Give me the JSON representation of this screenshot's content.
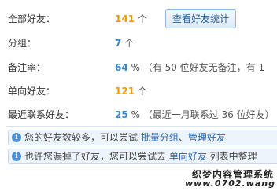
{
  "stats": {
    "total": {
      "label": "全部好友：",
      "value": "141",
      "unit": "个"
    },
    "groups": {
      "label": "分组：",
      "value": "7",
      "unit": "个"
    },
    "note_rate": {
      "label": "备注率：",
      "value": "64",
      "unit": "%",
      "detail": "（有 50 位好友无备注，有 1"
    },
    "one_way": {
      "label": "单向好友：",
      "value": "121",
      "unit": "个"
    },
    "recent": {
      "label": "最近联系好友：",
      "value": "25",
      "unit": "%",
      "detail": "（最近一月联系过 36 位好友）"
    }
  },
  "buttons": {
    "view_stats": "查看好友统计"
  },
  "tips": [
    {
      "prefix": "您的好友数较多，可以尝试 ",
      "links": [
        "批量分组",
        "管理好友"
      ],
      "sep": "、",
      "suffix": ""
    },
    {
      "prefix": "也许您漏掉了好友，您可以尝试去 ",
      "links": [
        "单向好友"
      ],
      "sep": "",
      "suffix": " 列表中整理"
    }
  ],
  "watermark": {
    "line1": "织梦内容管理系统",
    "url": "www.0702.wang"
  },
  "colors": {
    "accent_orange": "#f39800",
    "accent_blue": "#3a86c8",
    "link": "#2a63ad"
  }
}
